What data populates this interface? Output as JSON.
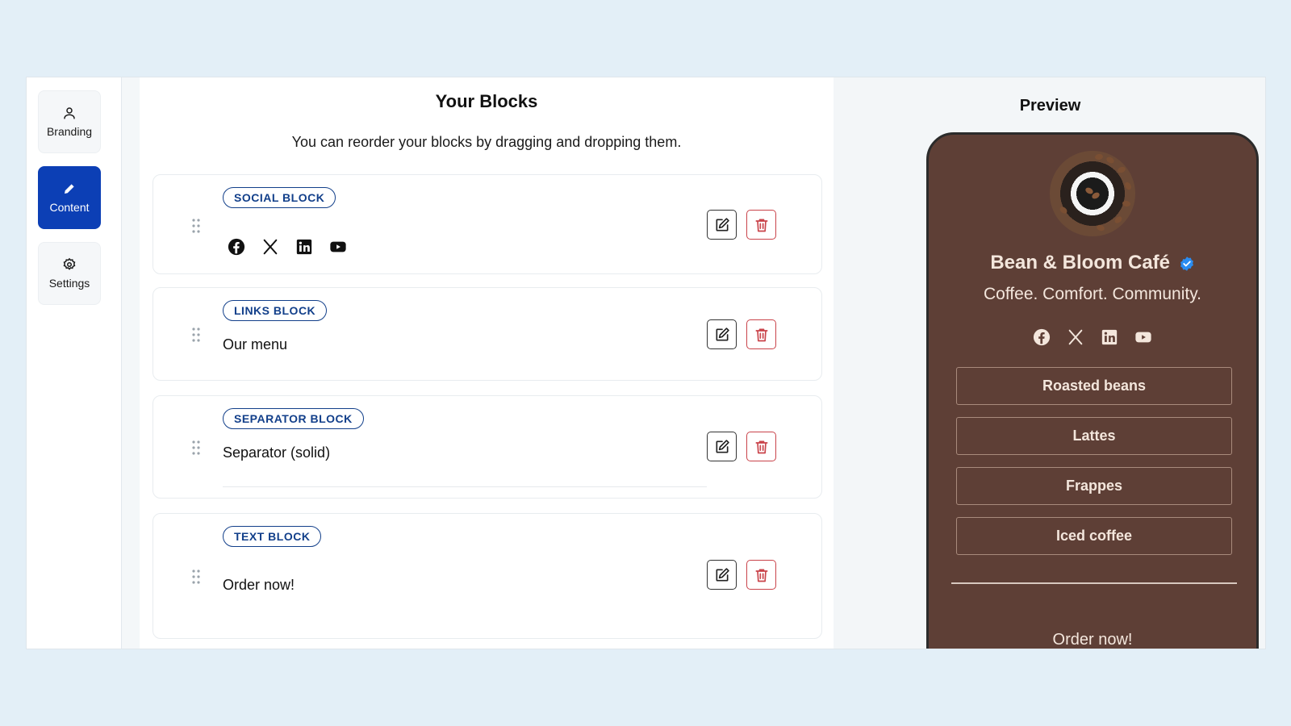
{
  "sidebar": {
    "items": [
      {
        "label": "Branding",
        "icon": "user-icon",
        "active": false
      },
      {
        "label": "Content",
        "icon": "pencil-icon",
        "active": true
      },
      {
        "label": "Settings",
        "icon": "gear-icon",
        "active": false
      }
    ]
  },
  "main": {
    "title": "Your Blocks",
    "subtitle": "You can reorder your blocks by dragging and dropping them.",
    "blocks": [
      {
        "type_label": "SOCIAL BLOCK",
        "icons": [
          "facebook-icon",
          "x-icon",
          "linkedin-icon",
          "youtube-icon"
        ]
      },
      {
        "type_label": "LINKS BLOCK",
        "text": "Our menu"
      },
      {
        "type_label": "SEPARATOR BLOCK",
        "text": "Separator (solid)"
      },
      {
        "type_label": "TEXT BLOCK",
        "text": "Order now!"
      }
    ]
  },
  "preview": {
    "title": "Preview",
    "brand_name": "Bean & Bloom Café",
    "tagline": "Coffee. Comfort. Community.",
    "links": [
      "Roasted beans",
      "Lattes",
      "Frappes",
      "Iced coffee"
    ],
    "text": "Order now!"
  },
  "colors": {
    "accent": "#0c3fb5",
    "badge": "#123f8a",
    "delete": "#c9434a",
    "phone_bg": "#5e3f36",
    "verified": "#2a8cf0"
  }
}
